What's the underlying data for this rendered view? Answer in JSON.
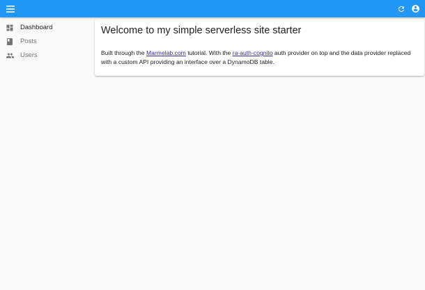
{
  "appbar": {
    "menu_icon": "menu-icon",
    "refresh_icon": "refresh-icon",
    "account_icon": "account-circle-icon",
    "color": "#2196f3"
  },
  "sidebar": {
    "items": [
      {
        "label": "Dashboard",
        "icon": "dashboard-icon",
        "active": true
      },
      {
        "label": "Posts",
        "icon": "book-icon",
        "active": false
      },
      {
        "label": "Users",
        "icon": "people-icon",
        "active": false
      }
    ]
  },
  "card": {
    "title": "Welcome to my simple serverless site starter",
    "body": {
      "text_1": "Built through the ",
      "link_1": "Marmelab.com",
      "text_2": " tutorial. With the ",
      "link_2": "ra-auth-cognito",
      "text_3": " auth provider on top and the data provider replaced with a custom API providing an interface over a DynamoDB table."
    }
  }
}
